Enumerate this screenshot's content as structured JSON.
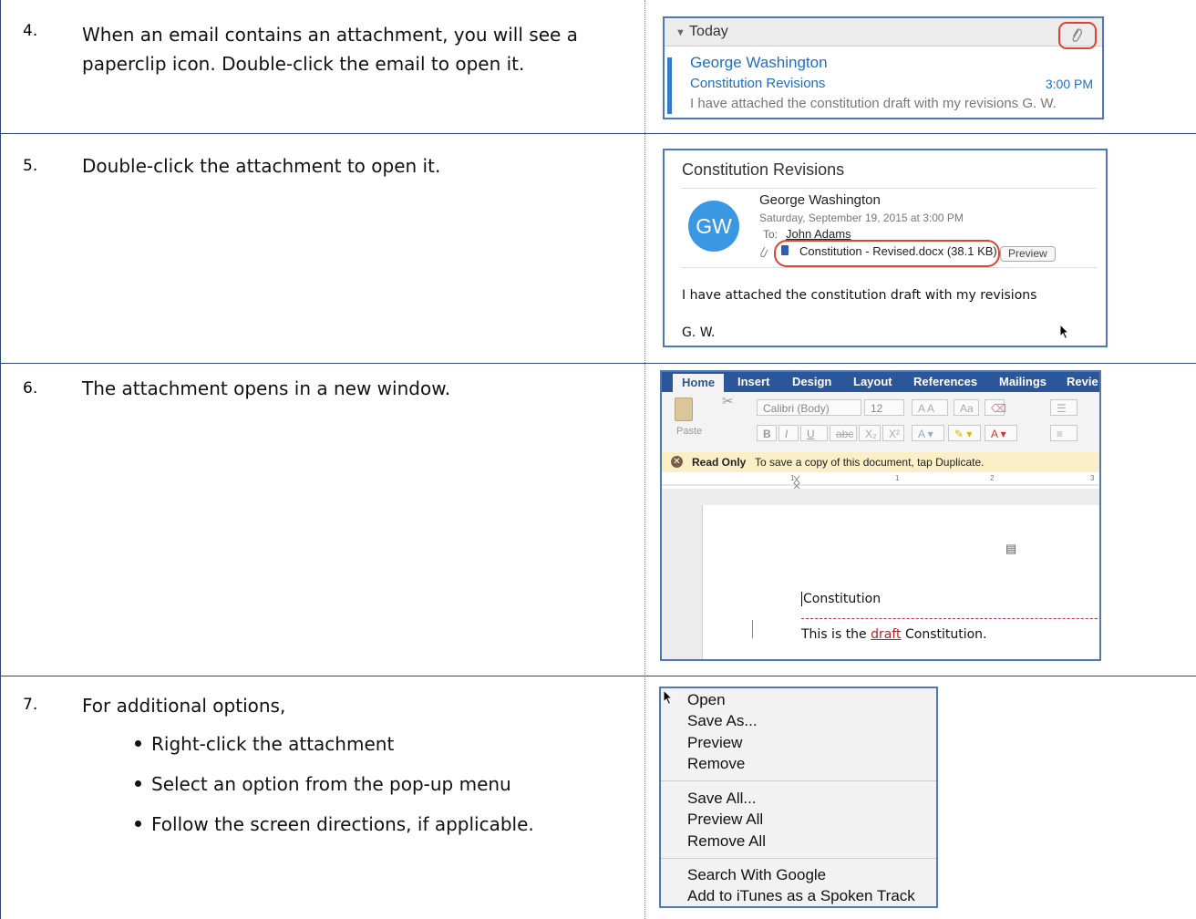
{
  "steps": [
    {
      "number": "4.",
      "text_lines": [
        "When an email contains an attachment, you will see a",
        "paperclip icon. Double-click the email to open it."
      ]
    },
    {
      "number": "5.",
      "text_lines": [
        "Double-click the attachment to open it."
      ]
    },
    {
      "number": "6.",
      "text_lines": [
        "The attachment opens in a new window."
      ]
    },
    {
      "number": "7.",
      "text_lines": [
        "For additional options,"
      ],
      "bullets": [
        "Right-click the attachment",
        "Select an option from the pop-up menu",
        "Follow the screen directions, if applicable."
      ]
    }
  ],
  "mail_list": {
    "group": "Today",
    "sender": "George Washington",
    "subject": "Constitution Revisions",
    "time": "3:00 PM",
    "preview": "I have attached the constitution draft with my revisions G. W."
  },
  "message": {
    "title": "Constitution Revisions",
    "avatar_initials": "GW",
    "from": "George Washington",
    "date": "Saturday, September 19, 2015 at 3:00 PM",
    "to_label": "To:",
    "to": "John Adams",
    "attachment": "Constitution - Revised.docx (38.1 KB)",
    "preview_button": "Preview",
    "body": "I have attached the constitution draft with my revisions",
    "signature": "G. W."
  },
  "word": {
    "tabs": [
      "Home",
      "Insert",
      "Design",
      "Layout",
      "References",
      "Mailings",
      "Revie"
    ],
    "font_name": "Calibri (Body)",
    "font_size": "12",
    "paste_label": "Paste",
    "read_only_label": "Read Only",
    "read_only_text": "To save a copy of this document, tap Duplicate.",
    "doc_title": "Constitution",
    "doc_line_before": "This is the ",
    "doc_line_draft": "draft",
    "doc_line_after": " Constitution.",
    "colors": {
      "ribbon": "#2b579a"
    }
  },
  "context_menu": {
    "groups": [
      [
        "Open",
        "Save As...",
        "Preview",
        "Remove"
      ],
      [
        "Save All...",
        "Preview All",
        "Remove All"
      ],
      [
        "Search With Google",
        "Add to iTunes as a Spoken Track"
      ]
    ]
  }
}
